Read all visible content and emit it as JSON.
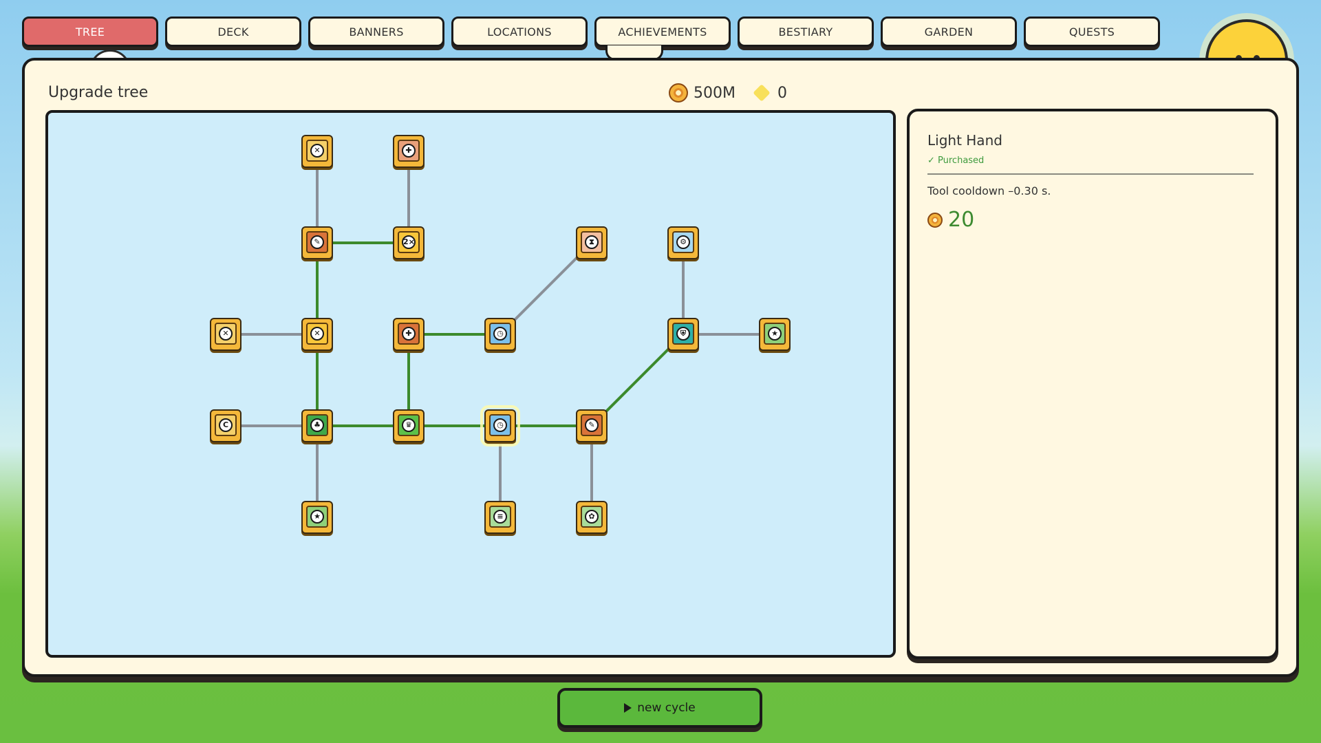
{
  "tabs": [
    {
      "label": "TREE",
      "active": true
    },
    {
      "label": "DECK",
      "active": false
    },
    {
      "label": "BANNERS",
      "active": false
    },
    {
      "label": "LOCATIONS",
      "active": false
    },
    {
      "label": "ACHIEVEMENTS",
      "active": false
    },
    {
      "label": "BESTIARY",
      "active": false
    },
    {
      "label": "GARDEN",
      "active": false
    },
    {
      "label": "QUESTS",
      "active": false
    }
  ],
  "header": {
    "title": "Upgrade tree",
    "coins": "500M",
    "gems": "0"
  },
  "tree": {
    "nodes": [
      {
        "id": "a1",
        "col": 2,
        "row": 0,
        "icon": "sword-icon",
        "glyph": "✕",
        "color": "#f4d06a",
        "selected": false
      },
      {
        "id": "a2",
        "col": 3,
        "row": 0,
        "icon": "gamepad-icon",
        "glyph": "✚",
        "color": "#e9a07a",
        "selected": false
      },
      {
        "id": "b1",
        "col": 2,
        "row": 1,
        "icon": "pen-icon",
        "glyph": "✎",
        "color": "#d9733a",
        "selected": false
      },
      {
        "id": "b2",
        "col": 3,
        "row": 1,
        "icon": "double-icon",
        "glyph": "2×",
        "color": "#f8c63a",
        "selected": false
      },
      {
        "id": "b3",
        "col": 5,
        "row": 1,
        "icon": "hourglass-icon",
        "glyph": "⧗",
        "color": "#f4bfa0",
        "selected": false
      },
      {
        "id": "b4",
        "col": 6,
        "row": 1,
        "icon": "gear-icon",
        "glyph": "⚙",
        "color": "#a8d8f0",
        "selected": false
      },
      {
        "id": "c1",
        "col": 1,
        "row": 2,
        "icon": "cross-icon",
        "glyph": "✕",
        "color": "#f4d06a",
        "selected": false
      },
      {
        "id": "c2",
        "col": 2,
        "row": 2,
        "icon": "sword-icon",
        "glyph": "✕",
        "color": "#f8c63a",
        "selected": false
      },
      {
        "id": "c3",
        "col": 3,
        "row": 2,
        "icon": "gamepad-icon",
        "glyph": "✚",
        "color": "#d9733a",
        "selected": false
      },
      {
        "id": "c4",
        "col": 4,
        "row": 2,
        "icon": "clock-icon",
        "glyph": "◷",
        "color": "#7cc0ea",
        "selected": false
      },
      {
        "id": "c5",
        "col": 6,
        "row": 2,
        "icon": "shield-icon",
        "glyph": "⛨",
        "color": "#2fb0a8",
        "selected": false
      },
      {
        "id": "c6",
        "col": 7,
        "row": 2,
        "icon": "star-icon",
        "glyph": "★",
        "color": "#8ed07a",
        "selected": false
      },
      {
        "id": "d1",
        "col": 1,
        "row": 3,
        "icon": "coin-icon",
        "glyph": "C",
        "color": "#f4d06a",
        "selected": false
      },
      {
        "id": "d2",
        "col": 2,
        "row": 3,
        "icon": "tree-icon",
        "glyph": "♣",
        "color": "#3fa84a",
        "selected": false
      },
      {
        "id": "d3",
        "col": 3,
        "row": 3,
        "icon": "crown-icon",
        "glyph": "♛",
        "color": "#5cc04a",
        "selected": false
      },
      {
        "id": "d4",
        "col": 4,
        "row": 3,
        "icon": "clock-icon",
        "glyph": "◷",
        "color": "#7cc0ea",
        "selected": true
      },
      {
        "id": "d5",
        "col": 5,
        "row": 3,
        "icon": "pen-icon",
        "glyph": "✎",
        "color": "#d9733a",
        "selected": false
      },
      {
        "id": "e1",
        "col": 2,
        "row": 4,
        "icon": "star-icon",
        "glyph": "★",
        "color": "#8ed07a",
        "selected": false
      },
      {
        "id": "e2",
        "col": 4,
        "row": 4,
        "icon": "bin-icon",
        "glyph": "≡",
        "color": "#a8dc9a",
        "selected": false
      },
      {
        "id": "e3",
        "col": 5,
        "row": 4,
        "icon": "tulip-icon",
        "glyph": "✿",
        "color": "#a8dc9a",
        "selected": false
      }
    ],
    "links": [
      {
        "from": "a1",
        "to": "b1",
        "active": false
      },
      {
        "from": "a2",
        "to": "b2",
        "active": false
      },
      {
        "from": "b1",
        "to": "b2",
        "active": true
      },
      {
        "from": "b1",
        "to": "c2",
        "active": true
      },
      {
        "from": "b3",
        "to": "c4",
        "active": false
      },
      {
        "from": "b4",
        "to": "c5",
        "active": false
      },
      {
        "from": "c1",
        "to": "c2",
        "active": false
      },
      {
        "from": "c2",
        "to": "d2",
        "active": true
      },
      {
        "from": "c3",
        "to": "c4",
        "active": true
      },
      {
        "from": "c3",
        "to": "d3",
        "active": true
      },
      {
        "from": "c5",
        "to": "c6",
        "active": false
      },
      {
        "from": "c5",
        "to": "d5",
        "active": true
      },
      {
        "from": "d1",
        "to": "d2",
        "active": false
      },
      {
        "from": "d2",
        "to": "d3",
        "active": true
      },
      {
        "from": "d3",
        "to": "d4",
        "active": true
      },
      {
        "from": "d4",
        "to": "d5",
        "active": true
      },
      {
        "from": "d2",
        "to": "e1",
        "active": false
      },
      {
        "from": "d4",
        "to": "e2",
        "active": false
      },
      {
        "from": "d5",
        "to": "e3",
        "active": false
      }
    ]
  },
  "detail": {
    "name": "Light Hand",
    "status": "✓ Purchased",
    "description": "Tool cooldown –0.30 s.",
    "cost": "20"
  },
  "footer": {
    "cycle_label": "new cycle"
  },
  "colors": {
    "active_link": "#3c8a2c",
    "inactive_link": "#8a9098",
    "active_tab": "#e06a6a"
  }
}
